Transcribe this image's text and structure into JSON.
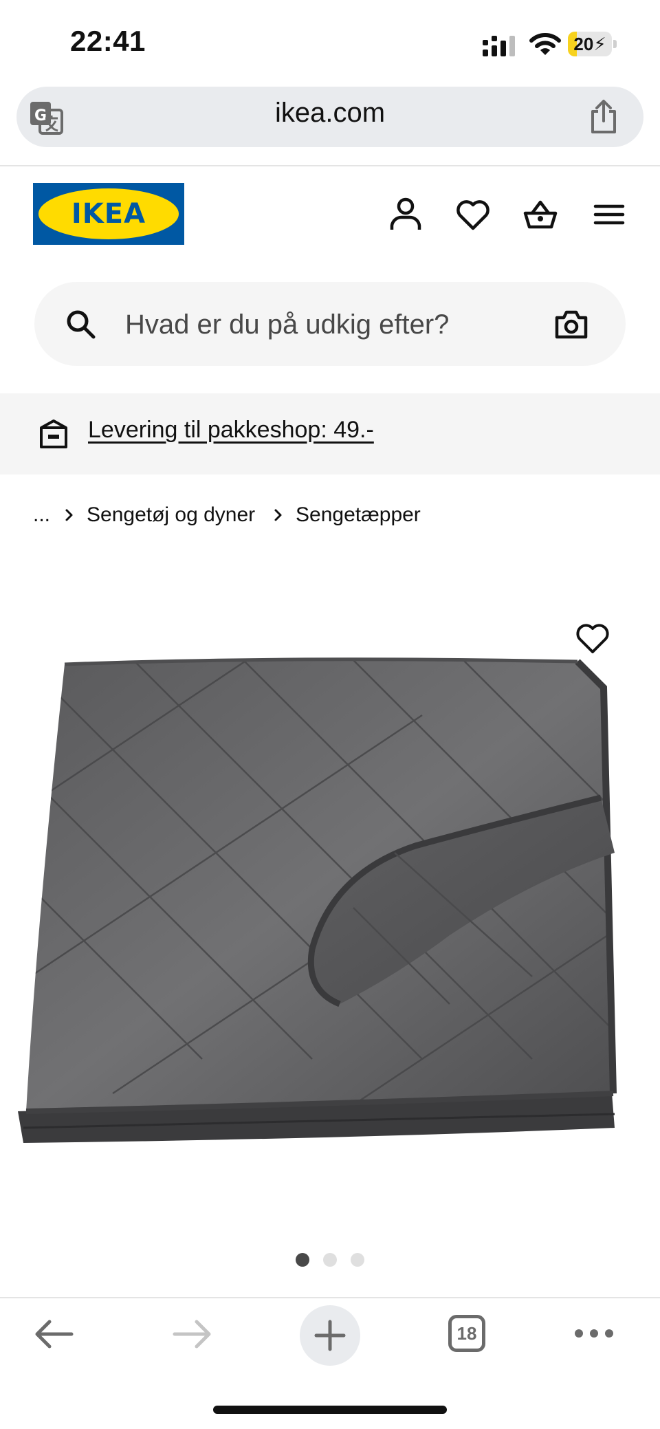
{
  "status_bar": {
    "time": "22:41",
    "battery_level": "20",
    "battery_fill_fraction": 0.2,
    "icons": [
      "cellular-signal-icon",
      "wifi-icon",
      "battery-charging-icon"
    ]
  },
  "browser": {
    "url": "ikea.com",
    "translate_icon": "translate-icon",
    "share_icon": "share-icon",
    "tab_count": "18",
    "toolbar_icons": [
      "back-arrow-icon",
      "forward-arrow-icon",
      "plus-icon",
      "tabs-icon",
      "more-icon"
    ]
  },
  "header": {
    "logo_text": "IKEA",
    "icons": [
      "account-icon",
      "wishlist-heart-icon",
      "shopping-basket-icon",
      "menu-icon"
    ],
    "colors": {
      "brand_blue": "#0058a3",
      "brand_yellow": "#ffdb00"
    }
  },
  "search": {
    "placeholder": "Hvad er du på udkig efter?",
    "icons": [
      "search-icon",
      "camera-icon"
    ]
  },
  "delivery": {
    "text": "Levering til pakkeshop: 49.-",
    "icon": "parcel-box-icon"
  },
  "breadcrumb": {
    "items": [
      "...",
      "Sengetøj og dyner",
      "Sengetæpper"
    ]
  },
  "product": {
    "image_description_icon": "quilted-bedspread-image",
    "favorite_icon": "heart-icon",
    "carousel": {
      "count": 3,
      "active": 0
    }
  }
}
